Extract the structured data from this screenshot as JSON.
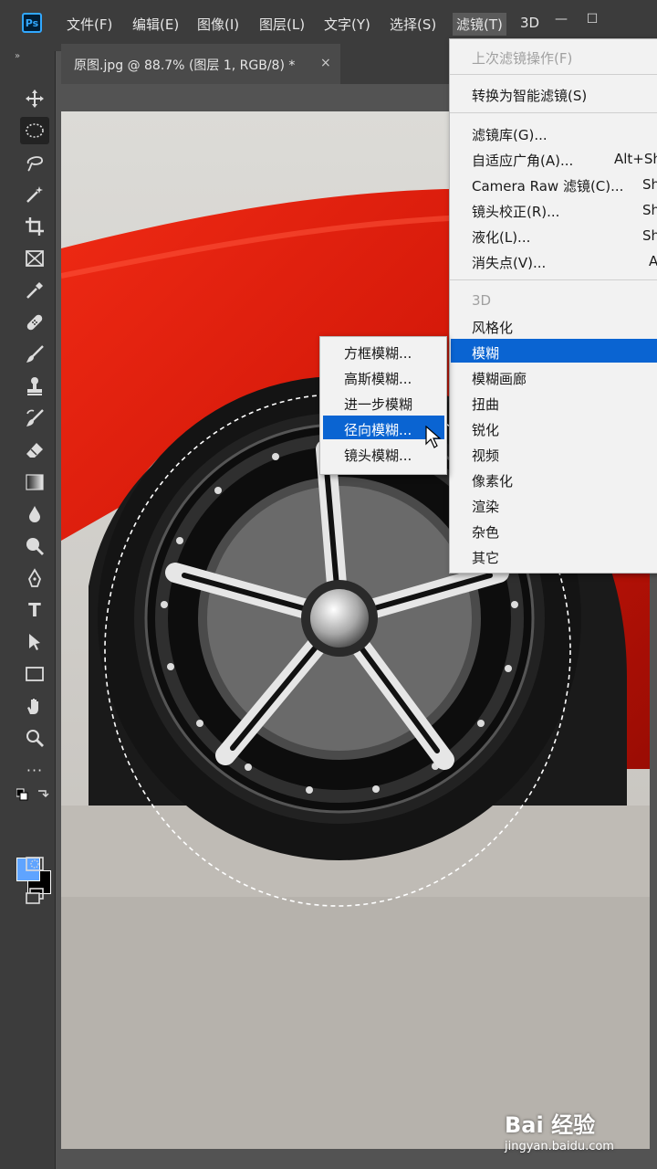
{
  "app": {
    "logo_text": "Ps"
  },
  "menubar": {
    "items": [
      "文件(F)",
      "编辑(E)",
      "图像(I)",
      "图层(L)",
      "文字(Y)",
      "选择(S)",
      "滤镜(T)",
      "3D"
    ],
    "active_index": 6
  },
  "window_controls": {
    "minimize": "—",
    "maximize": "☐"
  },
  "document_tab": {
    "title": "原图.jpg @ 88.7% (图层 1, RGB/8) *",
    "close": "×"
  },
  "toolbar": {
    "collapse": "»",
    "tools": [
      "move-tool",
      "elliptical-marquee-tool",
      "lasso-tool",
      "magic-wand-tool",
      "crop-tool",
      "frame-tool",
      "eyedropper-tool",
      "healing-brush-tool",
      "brush-tool",
      "clone-stamp-tool",
      "history-brush-tool",
      "eraser-tool",
      "gradient-tool",
      "blur-tool",
      "dodge-tool",
      "pen-tool",
      "type-tool",
      "path-selection-tool",
      "rectangle-tool",
      "hand-tool",
      "zoom-tool",
      "more-tools"
    ],
    "type_glyph": "T",
    "more_glyph": "···",
    "selected_index": 1,
    "foreground_color": "#5fa4ff",
    "background_color": "#000000"
  },
  "filter_menu": {
    "items": [
      {
        "label": "上次滤镜操作(F)",
        "disabled": true
      },
      {
        "label": "转换为智能滤镜(S)"
      },
      {
        "label": "滤镜库(G)..."
      },
      {
        "label": "自适应广角(A)...",
        "shortcut": "Alt+Sh"
      },
      {
        "label": "Camera Raw 滤镜(C)...",
        "shortcut": "Sh"
      },
      {
        "label": "镜头校正(R)...",
        "shortcut": "Sh"
      },
      {
        "label": "液化(L)...",
        "shortcut": "Sh"
      },
      {
        "label": "消失点(V)...",
        "shortcut": "A"
      },
      {
        "label": "3D",
        "disabled": true
      },
      {
        "label": "风格化"
      },
      {
        "label": "模糊",
        "highlighted": true
      },
      {
        "label": "模糊画廊"
      },
      {
        "label": "扭曲"
      },
      {
        "label": "锐化"
      },
      {
        "label": "视频"
      },
      {
        "label": "像素化"
      },
      {
        "label": "渲染"
      },
      {
        "label": "杂色"
      },
      {
        "label": "其它"
      }
    ]
  },
  "blur_submenu": {
    "items": [
      "方框模糊...",
      "高斯模糊...",
      "进一步模糊",
      "径向模糊...",
      "镜头模糊..."
    ],
    "highlighted_index": 3
  },
  "colors": {
    "accent": "#0a64d2",
    "car_red": "#d41a0a"
  },
  "watermark": {
    "main": "Bai 经验",
    "sub": "jingyan.baidu.com"
  }
}
